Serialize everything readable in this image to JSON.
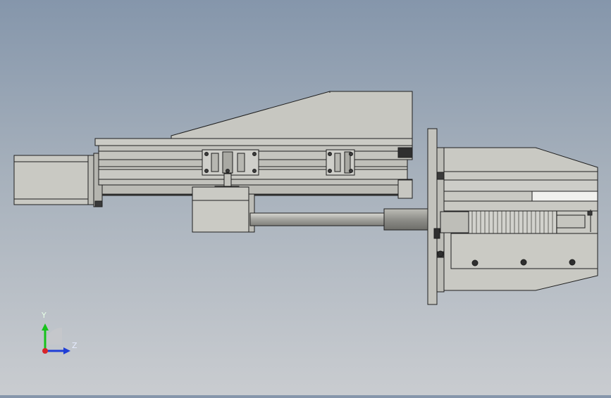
{
  "viewport": {
    "background_top": "#8596ab",
    "background_bottom": "#c9ccd0",
    "model": "linear-module-assembly"
  },
  "triad": {
    "y_label": "Y",
    "z_label": "Z",
    "y_color": "#16c21b",
    "z_color": "#1f3ed6",
    "x_color": "#d8242a"
  }
}
